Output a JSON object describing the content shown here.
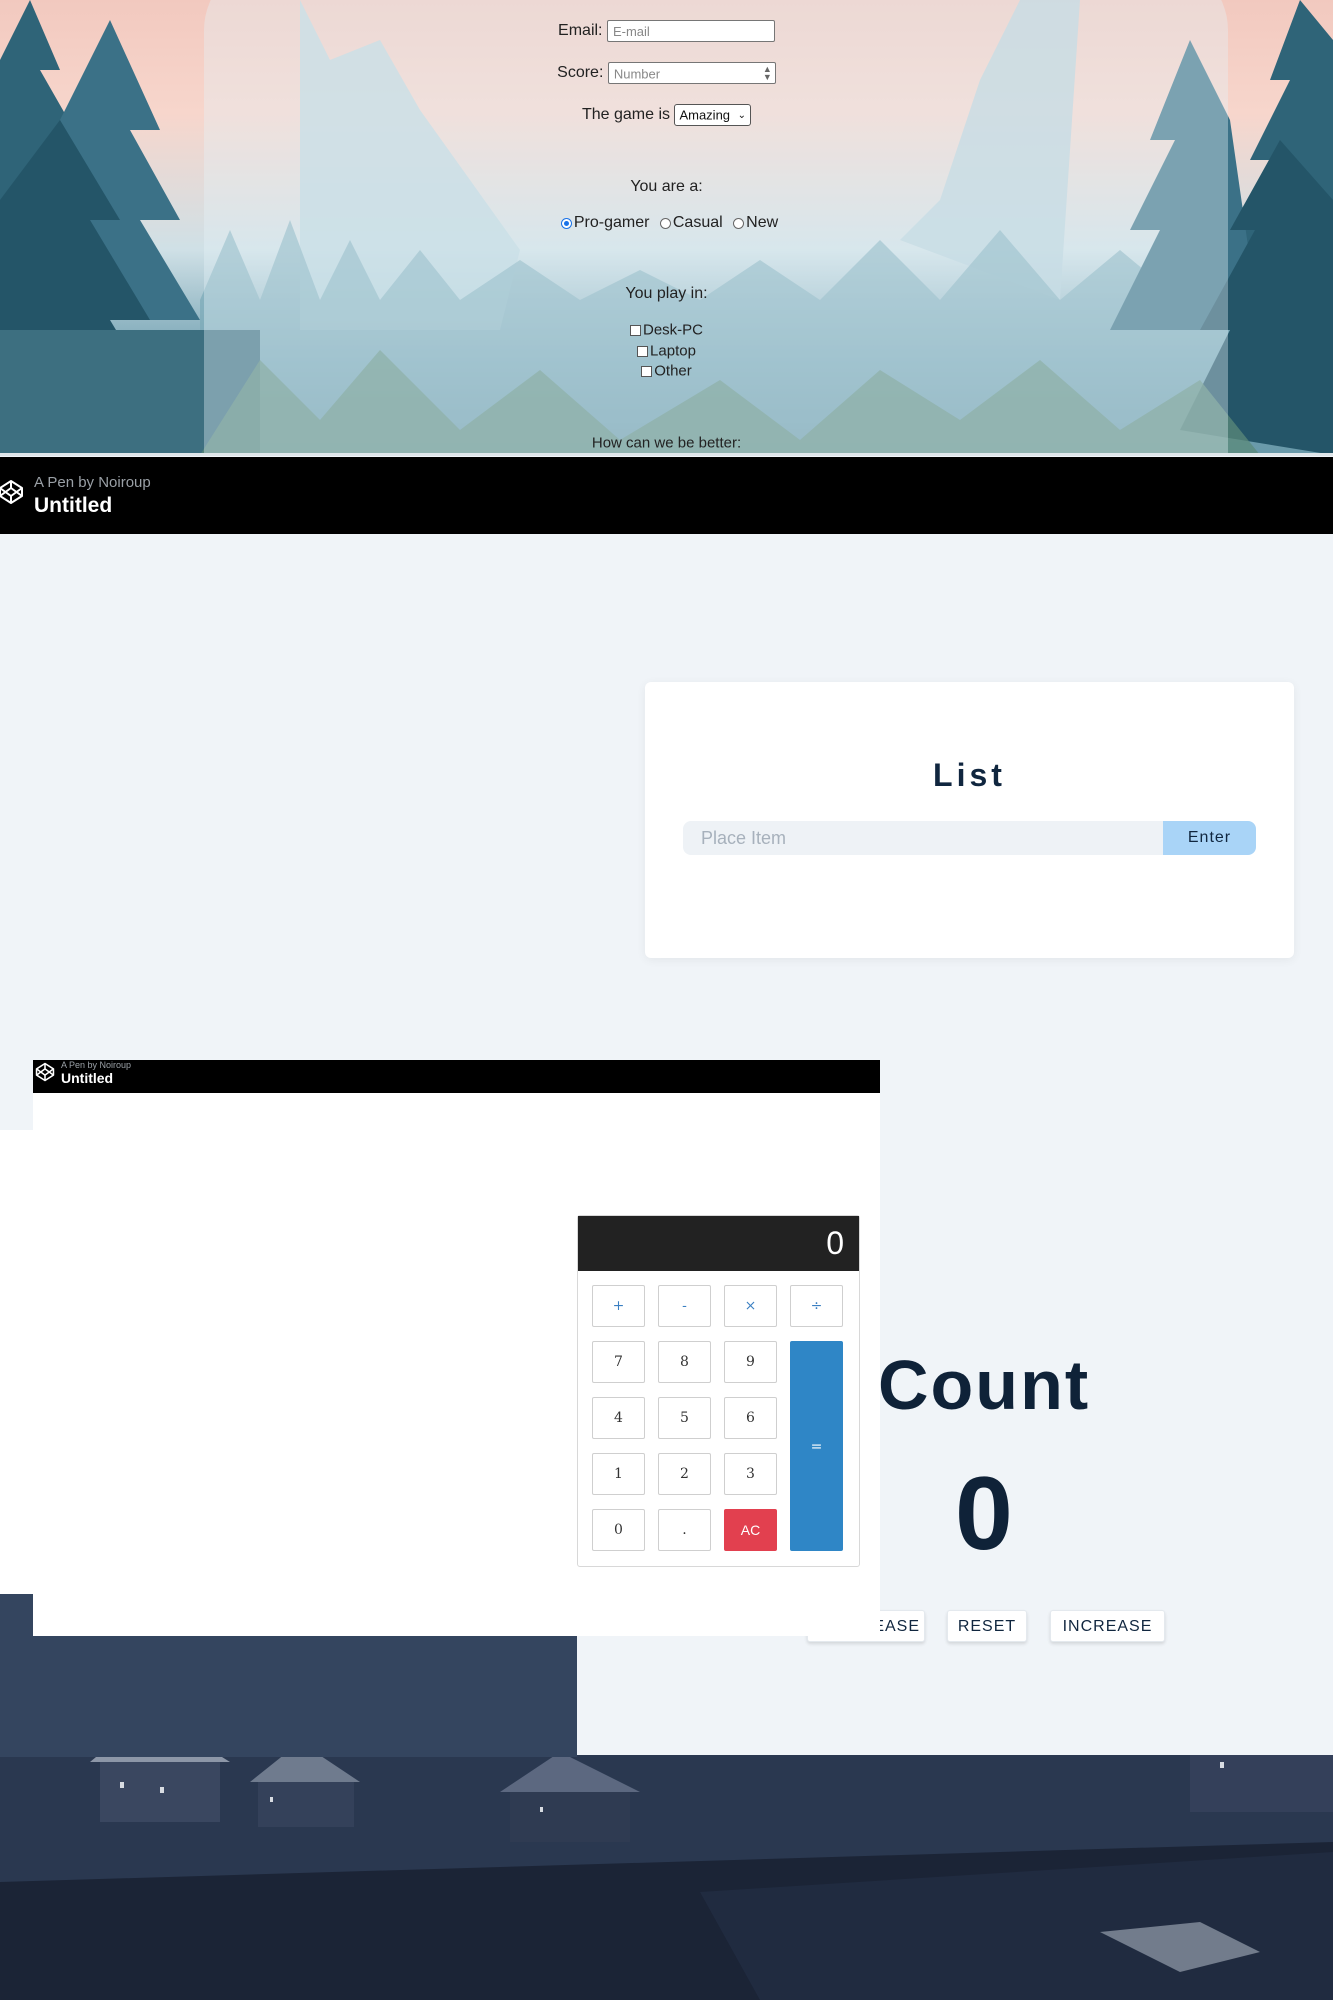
{
  "survey": {
    "email_label": "Email:",
    "email_placeholder": "E-mail",
    "score_label": "Score:",
    "score_placeholder": "Number",
    "game_label": "The game is",
    "game_selected": "Amazing",
    "you_are_label": "You are a:",
    "player_types": [
      {
        "label": "Pro-gamer",
        "checked": true
      },
      {
        "label": "Casual",
        "checked": false
      },
      {
        "label": "New",
        "checked": false
      }
    ],
    "play_in_label": "You play in:",
    "platforms": [
      "Desk-PC",
      "Laptop",
      "Other"
    ],
    "better_label": "How can we be better:"
  },
  "pen_header": {
    "byline": "A Pen by Noiroup",
    "title": "Untitled"
  },
  "list_app": {
    "title": "List",
    "input_placeholder": "Place Item",
    "enter_label": "Enter"
  },
  "calculator": {
    "byline": "A Pen by Noiroup",
    "title": "Untitled",
    "display": "0",
    "operators": [
      "+",
      "-",
      "×",
      "÷"
    ],
    "rows": [
      [
        "7",
        "8",
        "9"
      ],
      [
        "4",
        "5",
        "6"
      ],
      [
        "1",
        "2",
        "3"
      ],
      [
        "0",
        ".",
        "AC"
      ]
    ],
    "equals": "=",
    "colors": {
      "display_bg": "#222222",
      "equals": "#2f86c6",
      "clear": "#e2404f",
      "operator_text": "#3a7fc2"
    }
  },
  "counter": {
    "title": "Count",
    "value": "0",
    "buttons": {
      "decrease": "DECREASE",
      "reset": "RESET",
      "increase": "INCREASE"
    }
  }
}
